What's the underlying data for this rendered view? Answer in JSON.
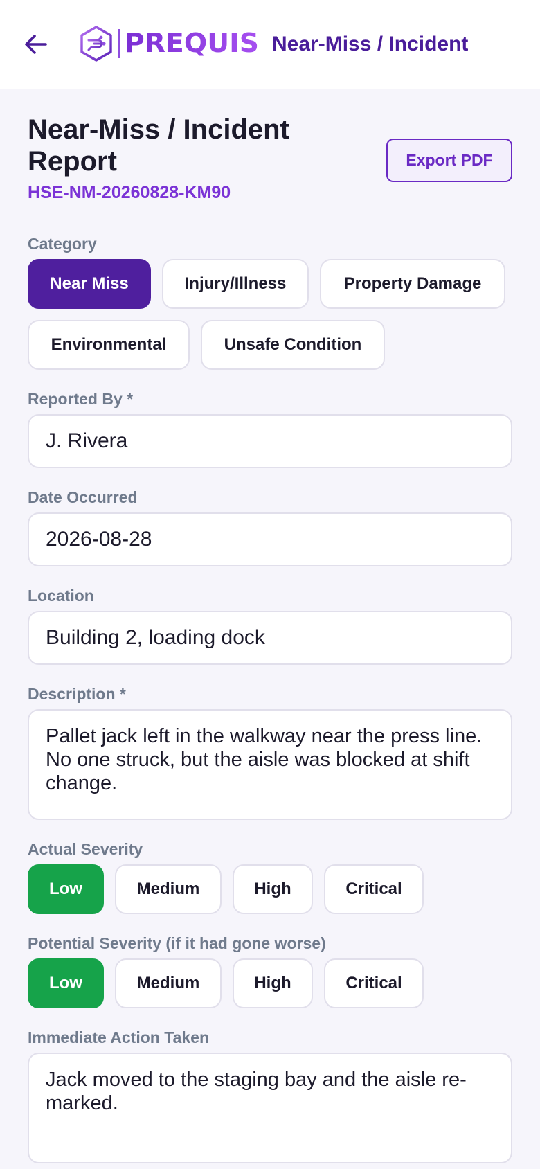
{
  "header": {
    "back_icon": "arrow-left-icon",
    "logo_text": "PREQUIS",
    "title": "Near-Miss / Incident"
  },
  "report": {
    "title": "Near-Miss / Incident Report",
    "id": "HSE-NM-20260828-KM90",
    "export_label": "Export PDF"
  },
  "category": {
    "label": "Category",
    "options": [
      "Near Miss",
      "Injury/Illness",
      "Property Damage",
      "Environmental",
      "Unsafe Condition"
    ],
    "selected": "Near Miss"
  },
  "reported_by": {
    "label": "Reported By *",
    "value": "J. Rivera"
  },
  "date_occurred": {
    "label": "Date Occurred",
    "value": "2026-08-28"
  },
  "location": {
    "label": "Location",
    "value": "Building 2, loading dock"
  },
  "description": {
    "label": "Description *",
    "value": "Pallet jack left in the walkway near the press line. No one struck, but the aisle was blocked at shift change."
  },
  "actual_severity": {
    "label": "Actual Severity",
    "options": [
      "Low",
      "Medium",
      "High",
      "Critical"
    ],
    "selected": "Low"
  },
  "potential_severity": {
    "label": "Potential Severity (if it had gone worse)",
    "options": [
      "Low",
      "Medium",
      "High",
      "Critical"
    ],
    "selected": "Low"
  },
  "immediate_action": {
    "label": "Immediate Action Taken",
    "value": "Jack moved to the staging bay and the aisle re-marked."
  },
  "colors": {
    "brand": "#4f1f9e",
    "accent": "#7b33d6",
    "severity_low": "#16a34a"
  }
}
